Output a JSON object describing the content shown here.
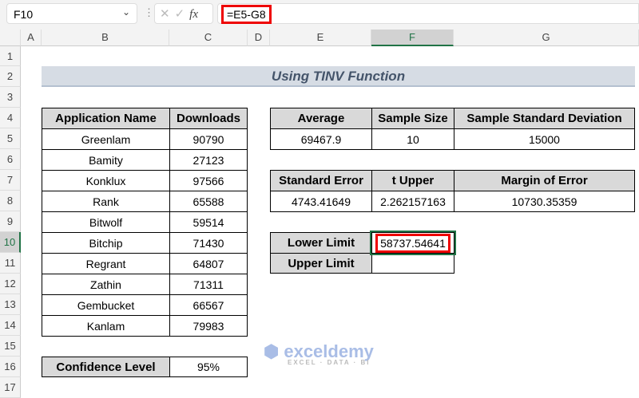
{
  "name_box": "F10",
  "formula": "=E5-G8",
  "columns": [
    "A",
    "B",
    "C",
    "D",
    "E",
    "F",
    "G"
  ],
  "rows": [
    "1",
    "2",
    "3",
    "4",
    "5",
    "6",
    "7",
    "8",
    "9",
    "10",
    "11",
    "12",
    "13",
    "14",
    "15",
    "16",
    "17"
  ],
  "title": "Using TINV Function",
  "table1": {
    "headers": [
      "Application Name",
      "Downloads"
    ],
    "rows": [
      [
        "Greenlam",
        "90790"
      ],
      [
        "Bamity",
        "27123"
      ],
      [
        "Konklux",
        "97566"
      ],
      [
        "Rank",
        "65588"
      ],
      [
        "Bitwolf",
        "59514"
      ],
      [
        "Bitchip",
        "71430"
      ],
      [
        "Regrant",
        "64807"
      ],
      [
        "Zathin",
        "71311"
      ],
      [
        "Gembucket",
        "66567"
      ],
      [
        "Kanlam",
        "79983"
      ]
    ]
  },
  "confidence": {
    "label": "Confidence Level",
    "value": "95%"
  },
  "stats1": {
    "headers": [
      "Average",
      "Sample Size",
      "Sample Standard Deviation"
    ],
    "values": [
      "69467.9",
      "10",
      "15000"
    ]
  },
  "stats2": {
    "headers": [
      "Standard Error",
      "t Upper",
      "Margin of Error"
    ],
    "values": [
      "4743.41649",
      "2.262157163",
      "10730.35359"
    ]
  },
  "limits": {
    "lower_label": "Lower Limit",
    "lower_value": "58737.54641",
    "upper_label": "Upper Limit",
    "upper_value": ""
  },
  "watermark": {
    "name": "exceldemy",
    "tagline": "EXCEL · DATA · BI"
  }
}
